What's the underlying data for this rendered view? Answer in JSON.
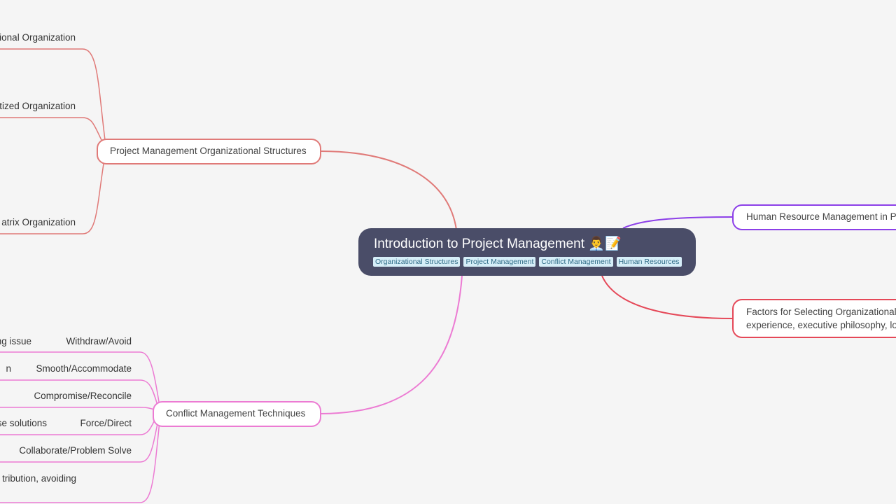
{
  "root": {
    "title": "Introduction to Project Management 👨‍💼📝",
    "tags": [
      "Organizational Structures",
      "Project Management",
      "Conflict Management",
      "Human Resources"
    ]
  },
  "branches": {
    "org_structures": {
      "label": "Project Management Organizational Structures",
      "color": "#e07a78",
      "children": [
        "ional Organization",
        "tized Organization",
        "atrix Organization"
      ]
    },
    "conflict": {
      "label": "Conflict Management Techniques",
      "color": "#ec7bd3",
      "children": [
        "Withdraw/Avoid",
        "Smooth/Accommodate",
        "Compromise/Reconcile",
        "Force/Direct",
        "Collaborate/Problem Solve"
      ],
      "details": [
        "ng issue",
        "n",
        "se solutions",
        "tribution, avoiding"
      ]
    },
    "hr": {
      "label": "Human Resource Management in Pro",
      "color": "#8c3fe8"
    },
    "factors": {
      "label_line1": "Factors for Selecting Organizational",
      "label_line2": "experience, executive philosophy, lo",
      "color": "#e54858"
    }
  }
}
